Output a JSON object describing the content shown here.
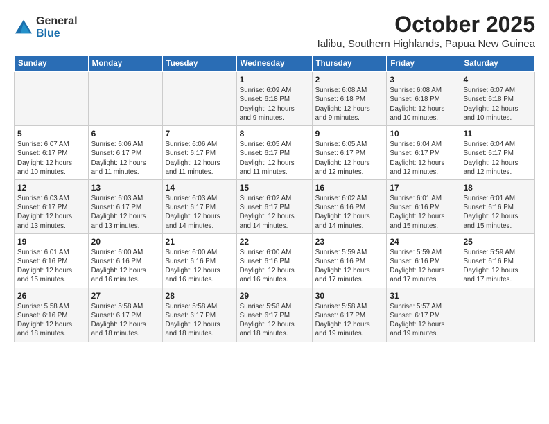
{
  "logo": {
    "general": "General",
    "blue": "Blue"
  },
  "header": {
    "month": "October 2025",
    "location": "Ialibu, Southern Highlands, Papua New Guinea"
  },
  "weekdays": [
    "Sunday",
    "Monday",
    "Tuesday",
    "Wednesday",
    "Thursday",
    "Friday",
    "Saturday"
  ],
  "weeks": [
    [
      {
        "day": "",
        "info": ""
      },
      {
        "day": "",
        "info": ""
      },
      {
        "day": "",
        "info": ""
      },
      {
        "day": "1",
        "info": "Sunrise: 6:09 AM\nSunset: 6:18 PM\nDaylight: 12 hours\nand 9 minutes."
      },
      {
        "day": "2",
        "info": "Sunrise: 6:08 AM\nSunset: 6:18 PM\nDaylight: 12 hours\nand 9 minutes."
      },
      {
        "day": "3",
        "info": "Sunrise: 6:08 AM\nSunset: 6:18 PM\nDaylight: 12 hours\nand 10 minutes."
      },
      {
        "day": "4",
        "info": "Sunrise: 6:07 AM\nSunset: 6:18 PM\nDaylight: 12 hours\nand 10 minutes."
      }
    ],
    [
      {
        "day": "5",
        "info": "Sunrise: 6:07 AM\nSunset: 6:17 PM\nDaylight: 12 hours\nand 10 minutes."
      },
      {
        "day": "6",
        "info": "Sunrise: 6:06 AM\nSunset: 6:17 PM\nDaylight: 12 hours\nand 11 minutes."
      },
      {
        "day": "7",
        "info": "Sunrise: 6:06 AM\nSunset: 6:17 PM\nDaylight: 12 hours\nand 11 minutes."
      },
      {
        "day": "8",
        "info": "Sunrise: 6:05 AM\nSunset: 6:17 PM\nDaylight: 12 hours\nand 11 minutes."
      },
      {
        "day": "9",
        "info": "Sunrise: 6:05 AM\nSunset: 6:17 PM\nDaylight: 12 hours\nand 12 minutes."
      },
      {
        "day": "10",
        "info": "Sunrise: 6:04 AM\nSunset: 6:17 PM\nDaylight: 12 hours\nand 12 minutes."
      },
      {
        "day": "11",
        "info": "Sunrise: 6:04 AM\nSunset: 6:17 PM\nDaylight: 12 hours\nand 12 minutes."
      }
    ],
    [
      {
        "day": "12",
        "info": "Sunrise: 6:03 AM\nSunset: 6:17 PM\nDaylight: 12 hours\nand 13 minutes."
      },
      {
        "day": "13",
        "info": "Sunrise: 6:03 AM\nSunset: 6:17 PM\nDaylight: 12 hours\nand 13 minutes."
      },
      {
        "day": "14",
        "info": "Sunrise: 6:03 AM\nSunset: 6:17 PM\nDaylight: 12 hours\nand 14 minutes."
      },
      {
        "day": "15",
        "info": "Sunrise: 6:02 AM\nSunset: 6:17 PM\nDaylight: 12 hours\nand 14 minutes."
      },
      {
        "day": "16",
        "info": "Sunrise: 6:02 AM\nSunset: 6:16 PM\nDaylight: 12 hours\nand 14 minutes."
      },
      {
        "day": "17",
        "info": "Sunrise: 6:01 AM\nSunset: 6:16 PM\nDaylight: 12 hours\nand 15 minutes."
      },
      {
        "day": "18",
        "info": "Sunrise: 6:01 AM\nSunset: 6:16 PM\nDaylight: 12 hours\nand 15 minutes."
      }
    ],
    [
      {
        "day": "19",
        "info": "Sunrise: 6:01 AM\nSunset: 6:16 PM\nDaylight: 12 hours\nand 15 minutes."
      },
      {
        "day": "20",
        "info": "Sunrise: 6:00 AM\nSunset: 6:16 PM\nDaylight: 12 hours\nand 16 minutes."
      },
      {
        "day": "21",
        "info": "Sunrise: 6:00 AM\nSunset: 6:16 PM\nDaylight: 12 hours\nand 16 minutes."
      },
      {
        "day": "22",
        "info": "Sunrise: 6:00 AM\nSunset: 6:16 PM\nDaylight: 12 hours\nand 16 minutes."
      },
      {
        "day": "23",
        "info": "Sunrise: 5:59 AM\nSunset: 6:16 PM\nDaylight: 12 hours\nand 17 minutes."
      },
      {
        "day": "24",
        "info": "Sunrise: 5:59 AM\nSunset: 6:16 PM\nDaylight: 12 hours\nand 17 minutes."
      },
      {
        "day": "25",
        "info": "Sunrise: 5:59 AM\nSunset: 6:16 PM\nDaylight: 12 hours\nand 17 minutes."
      }
    ],
    [
      {
        "day": "26",
        "info": "Sunrise: 5:58 AM\nSunset: 6:16 PM\nDaylight: 12 hours\nand 18 minutes."
      },
      {
        "day": "27",
        "info": "Sunrise: 5:58 AM\nSunset: 6:17 PM\nDaylight: 12 hours\nand 18 minutes."
      },
      {
        "day": "28",
        "info": "Sunrise: 5:58 AM\nSunset: 6:17 PM\nDaylight: 12 hours\nand 18 minutes."
      },
      {
        "day": "29",
        "info": "Sunrise: 5:58 AM\nSunset: 6:17 PM\nDaylight: 12 hours\nand 18 minutes."
      },
      {
        "day": "30",
        "info": "Sunrise: 5:58 AM\nSunset: 6:17 PM\nDaylight: 12 hours\nand 19 minutes."
      },
      {
        "day": "31",
        "info": "Sunrise: 5:57 AM\nSunset: 6:17 PM\nDaylight: 12 hours\nand 19 minutes."
      },
      {
        "day": "",
        "info": ""
      }
    ]
  ]
}
